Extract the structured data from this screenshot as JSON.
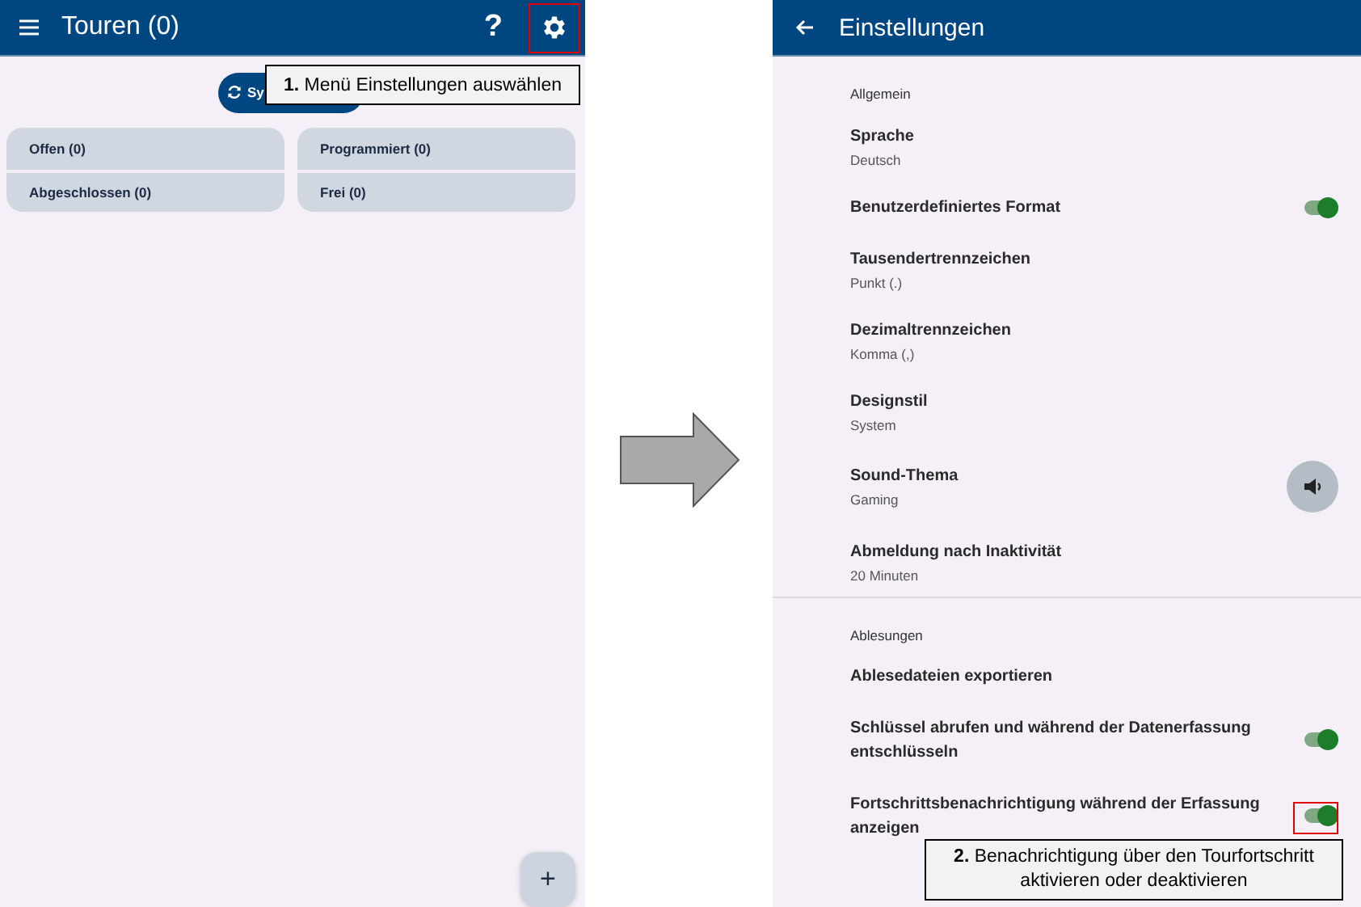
{
  "tours_screen": {
    "title": "Touren (0)",
    "help_label": "?",
    "settings_button": {
      "highlighted": true
    },
    "sync_button": {
      "label": "Sy"
    },
    "callout": "**1.** Menü Einstellungen auswählen",
    "groups": [
      {
        "label": "Offen (0)"
      },
      {
        "label": "Programmiert (0)"
      },
      {
        "label": "Abgeschlossen (0)"
      },
      {
        "label": "Frei (0)"
      }
    ],
    "fab_label": "+"
  },
  "settings_screen": {
    "title": "Einstellungen",
    "sections": [
      {
        "header": "Allgemein",
        "items": [
          {
            "kind": "value",
            "title": "Sprache",
            "value": "Deutsch"
          },
          {
            "kind": "toggle",
            "title": "Benutzerdefiniertes Format",
            "on": true,
            "highlighted": false
          },
          {
            "kind": "value",
            "title": "Tausendertrennzeichen",
            "value": "Punkt (.)"
          },
          {
            "kind": "value",
            "title": "Dezimaltrennzeichen",
            "value": "Komma (,)"
          },
          {
            "kind": "value",
            "title": "Designstil",
            "value": "System"
          },
          {
            "kind": "sound",
            "title": "Sound-Thema",
            "value": "Gaming"
          },
          {
            "kind": "value",
            "title": "Abmeldung nach Inaktivität",
            "value": "20 Minuten"
          }
        ]
      },
      {
        "header": "Ablesungen",
        "items": [
          {
            "kind": "action",
            "title": "Ablesedateien exportieren"
          },
          {
            "kind": "toggle",
            "title": "Schlüssel abrufen und während der Datenerfassung entschlüsseln",
            "on": true,
            "highlighted": false
          },
          {
            "kind": "toggle",
            "title": "Fortschrittsbenachrichtigung während der Erfassung anzeigen",
            "on": true,
            "highlighted": true
          }
        ]
      }
    ],
    "callout": "**2.** Benachrichtigung über den Tourfortschritt aktivieren oder deaktivieren"
  }
}
